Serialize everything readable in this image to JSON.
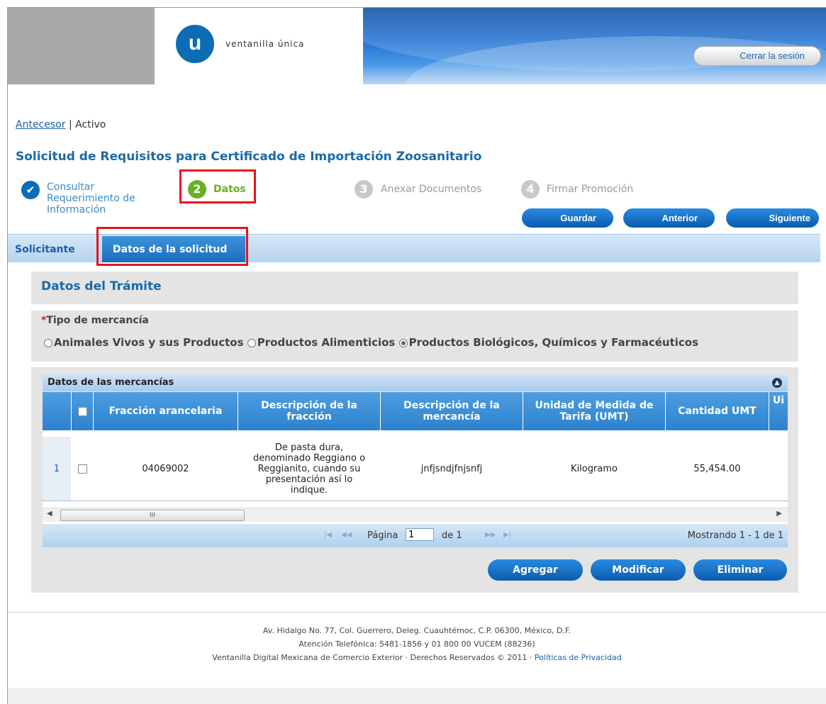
{
  "header": {
    "logo_letter": "u",
    "logo_text": "ventanilla única",
    "logout_label": "Cerrar la sesión"
  },
  "breadcrumb": {
    "link": "Antecesor",
    "separator": "|",
    "current": "Activo"
  },
  "page_title": "Solicitud de Requisitos para Certificado de Importación Zoosanitario",
  "steps": [
    {
      "number": "✔",
      "label": "Consultar Requerimiento de Información",
      "state": "done"
    },
    {
      "number": "2",
      "label": "Datos",
      "state": "active"
    },
    {
      "number": "3",
      "label": "Anexar Documentos",
      "state": "pending"
    },
    {
      "number": "4",
      "label": "Firmar Promoción",
      "state": "pending"
    }
  ],
  "actions": {
    "save": "Guardar",
    "previous": "Anterior",
    "next": "Siguiente"
  },
  "tabs": [
    {
      "label": "Solicitante",
      "selected": false
    },
    {
      "label": "Datos de la solicitud",
      "selected": true
    }
  ],
  "tramite": {
    "title": "Datos del Trámite"
  },
  "tipo_mercancia": {
    "required_mark": "*",
    "label": "Tipo de mercancía",
    "options": [
      {
        "label": "Animales Vivos y sus Productos",
        "selected": false
      },
      {
        "label": "Productos Alimenticios",
        "selected": false
      },
      {
        "label": "Productos Biológicos, Químicos y Farmacéuticos",
        "selected": true
      }
    ]
  },
  "grid": {
    "title": "Datos de las mercancías",
    "columns": [
      "Fracción arancelaria",
      "Descripción de la fracción",
      "Descripción de la mercancía",
      "Unidad de Medida de Tarifa (UMT)",
      "Cantidad UMT",
      "Ui"
    ],
    "rows": [
      {
        "index": "1",
        "fraccion": "04069002",
        "descripcion_fraccion": "De pasta dura, denominado Reggiano o Reggianito, cuando su presentación así lo indique.",
        "descripcion_mercancia": "jnfjsndjfnjsnfj",
        "umt": "Kilogramo",
        "cantidad": "55,454.00"
      }
    ],
    "scroll_thumb": "III",
    "pager": {
      "page_label": "Página",
      "page_value": "1",
      "of_label": "de 1",
      "status": "Mostrando 1 - 1 de 1"
    },
    "buttons": {
      "add": "Agregar",
      "edit": "Modificar",
      "delete": "Eliminar"
    }
  },
  "footer": {
    "line1": "Av. Hidalgo No. 77, Col. Guerrero, Deleg. Cuauhtémoc, C.P. 06300, México, D.F.",
    "line2": "Atención Telefónica: 5481-1856 y 01 800 00 VUCEM (88236)",
    "line3": "Ventanilla Digital Mexicana de Comercio Exterior · Derechos Reservados © 2011 ·",
    "privacy_link": "Políticas de Privacidad"
  },
  "colors": {
    "accent": "#0c6db4",
    "title": "#1a6aa8",
    "step_active": "#6ab023",
    "highlight": "#e8141b"
  }
}
